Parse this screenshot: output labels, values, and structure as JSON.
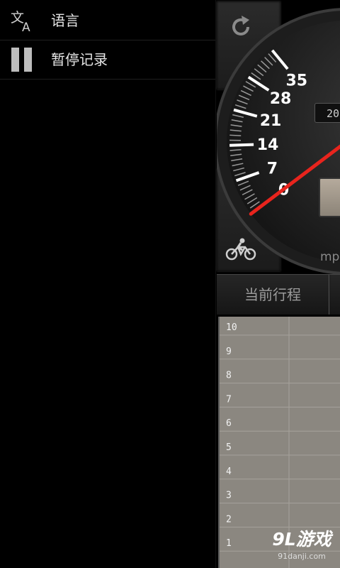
{
  "drawer": {
    "items": [
      {
        "label": "语言",
        "icon": "translate-icon"
      },
      {
        "label": "暂停记录",
        "icon": "pause-icon"
      }
    ]
  },
  "speedometer": {
    "tick_labels": [
      "0",
      "7",
      "14",
      "21",
      "28",
      "35"
    ],
    "odometer": "20",
    "unit": "mp",
    "needle_color": "#e8241d",
    "refresh_icon": "refresh-icon",
    "mode_icon": "bicycle-icon"
  },
  "tabs": [
    "当前行程",
    ""
  ],
  "chart": {
    "y_ticks": [
      "10",
      "9",
      "8",
      "7",
      "6",
      "5",
      "4",
      "3",
      "2",
      "1"
    ],
    "background": "#8b8780"
  },
  "watermark": {
    "logo": "9L游戏",
    "url": "91danji.com"
  }
}
